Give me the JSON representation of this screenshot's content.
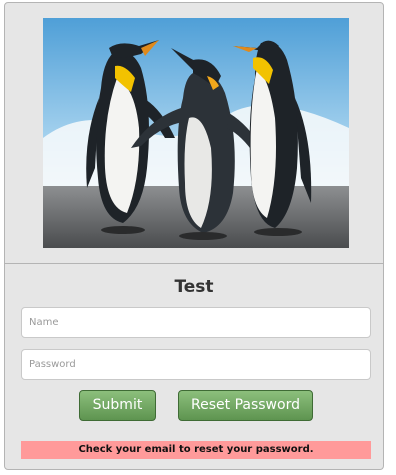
{
  "image": {
    "alt_icon": "penguins-photo"
  },
  "form": {
    "title": "Test",
    "name_placeholder": "Name",
    "password_placeholder": "Password",
    "submit_label": "Submit",
    "reset_label": "Reset Password",
    "message": "Check your email to reset your password."
  },
  "colors": {
    "panel_bg": "#e6e6e6",
    "button_green": "#6fa35f",
    "message_bg": "#ff9a9a"
  }
}
